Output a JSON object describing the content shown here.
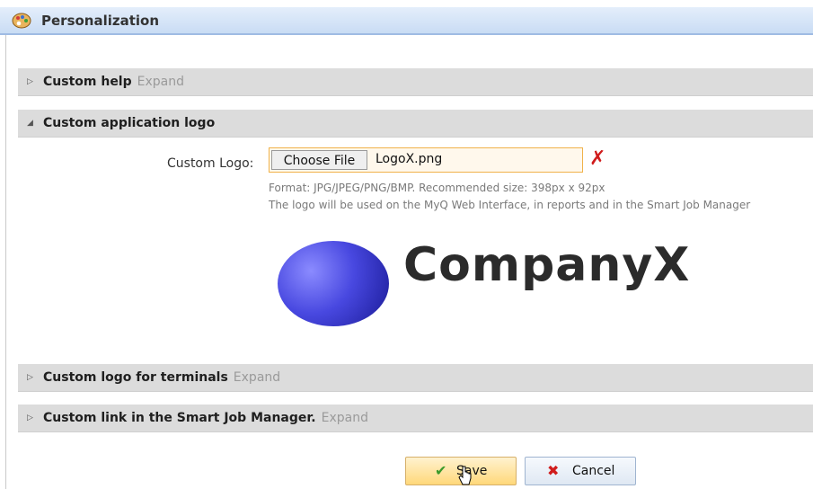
{
  "header": {
    "title": "Personalization",
    "icon": "palette-icon"
  },
  "sections": {
    "custom_help": {
      "title": "Custom help",
      "expand": "Expand",
      "state": "collapsed"
    },
    "custom_app_logo": {
      "title": "Custom application logo",
      "state": "expanded"
    },
    "custom_logo_terminals": {
      "title": "Custom logo for terminals",
      "expand": "Expand",
      "state": "collapsed"
    },
    "custom_link_sjm": {
      "title": "Custom link in the Smart Job Manager.",
      "expand": "Expand",
      "state": "collapsed"
    }
  },
  "logo_field": {
    "label": "Custom Logo:",
    "choose_file": "Choose File",
    "filename": "LogoX.png",
    "hint_format": "Format: JPG/JPEG/PNG/BMP. Recommended size: 398px x 92px",
    "hint_usage": "The logo will be used on the MyQ Web Interface, in reports and in the Smart Job Manager",
    "preview_text": "CompanyX"
  },
  "buttons": {
    "save": "Save",
    "cancel": "Cancel"
  },
  "colors": {
    "header_gradient_top": "#e4eefb",
    "header_border": "#9fbbe3",
    "section_bg": "#dcdcdc",
    "file_border": "#f0b24a",
    "delete_red": "#d01c1c",
    "save_green": "#3b9a2b",
    "logo_blue": "#4848e0"
  }
}
